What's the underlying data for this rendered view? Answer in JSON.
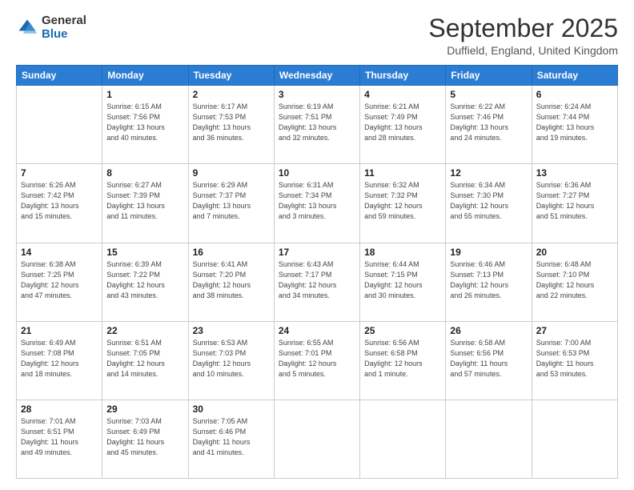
{
  "header": {
    "logo_general": "General",
    "logo_blue": "Blue",
    "title": "September 2025",
    "location": "Duffield, England, United Kingdom"
  },
  "days_of_week": [
    "Sunday",
    "Monday",
    "Tuesday",
    "Wednesday",
    "Thursday",
    "Friday",
    "Saturday"
  ],
  "weeks": [
    [
      {
        "day": "",
        "info": ""
      },
      {
        "day": "1",
        "info": "Sunrise: 6:15 AM\nSunset: 7:56 PM\nDaylight: 13 hours\nand 40 minutes."
      },
      {
        "day": "2",
        "info": "Sunrise: 6:17 AM\nSunset: 7:53 PM\nDaylight: 13 hours\nand 36 minutes."
      },
      {
        "day": "3",
        "info": "Sunrise: 6:19 AM\nSunset: 7:51 PM\nDaylight: 13 hours\nand 32 minutes."
      },
      {
        "day": "4",
        "info": "Sunrise: 6:21 AM\nSunset: 7:49 PM\nDaylight: 13 hours\nand 28 minutes."
      },
      {
        "day": "5",
        "info": "Sunrise: 6:22 AM\nSunset: 7:46 PM\nDaylight: 13 hours\nand 24 minutes."
      },
      {
        "day": "6",
        "info": "Sunrise: 6:24 AM\nSunset: 7:44 PM\nDaylight: 13 hours\nand 19 minutes."
      }
    ],
    [
      {
        "day": "7",
        "info": "Sunrise: 6:26 AM\nSunset: 7:42 PM\nDaylight: 13 hours\nand 15 minutes."
      },
      {
        "day": "8",
        "info": "Sunrise: 6:27 AM\nSunset: 7:39 PM\nDaylight: 13 hours\nand 11 minutes."
      },
      {
        "day": "9",
        "info": "Sunrise: 6:29 AM\nSunset: 7:37 PM\nDaylight: 13 hours\nand 7 minutes."
      },
      {
        "day": "10",
        "info": "Sunrise: 6:31 AM\nSunset: 7:34 PM\nDaylight: 13 hours\nand 3 minutes."
      },
      {
        "day": "11",
        "info": "Sunrise: 6:32 AM\nSunset: 7:32 PM\nDaylight: 12 hours\nand 59 minutes."
      },
      {
        "day": "12",
        "info": "Sunrise: 6:34 AM\nSunset: 7:30 PM\nDaylight: 12 hours\nand 55 minutes."
      },
      {
        "day": "13",
        "info": "Sunrise: 6:36 AM\nSunset: 7:27 PM\nDaylight: 12 hours\nand 51 minutes."
      }
    ],
    [
      {
        "day": "14",
        "info": "Sunrise: 6:38 AM\nSunset: 7:25 PM\nDaylight: 12 hours\nand 47 minutes."
      },
      {
        "day": "15",
        "info": "Sunrise: 6:39 AM\nSunset: 7:22 PM\nDaylight: 12 hours\nand 43 minutes."
      },
      {
        "day": "16",
        "info": "Sunrise: 6:41 AM\nSunset: 7:20 PM\nDaylight: 12 hours\nand 38 minutes."
      },
      {
        "day": "17",
        "info": "Sunrise: 6:43 AM\nSunset: 7:17 PM\nDaylight: 12 hours\nand 34 minutes."
      },
      {
        "day": "18",
        "info": "Sunrise: 6:44 AM\nSunset: 7:15 PM\nDaylight: 12 hours\nand 30 minutes."
      },
      {
        "day": "19",
        "info": "Sunrise: 6:46 AM\nSunset: 7:13 PM\nDaylight: 12 hours\nand 26 minutes."
      },
      {
        "day": "20",
        "info": "Sunrise: 6:48 AM\nSunset: 7:10 PM\nDaylight: 12 hours\nand 22 minutes."
      }
    ],
    [
      {
        "day": "21",
        "info": "Sunrise: 6:49 AM\nSunset: 7:08 PM\nDaylight: 12 hours\nand 18 minutes."
      },
      {
        "day": "22",
        "info": "Sunrise: 6:51 AM\nSunset: 7:05 PM\nDaylight: 12 hours\nand 14 minutes."
      },
      {
        "day": "23",
        "info": "Sunrise: 6:53 AM\nSunset: 7:03 PM\nDaylight: 12 hours\nand 10 minutes."
      },
      {
        "day": "24",
        "info": "Sunrise: 6:55 AM\nSunset: 7:01 PM\nDaylight: 12 hours\nand 5 minutes."
      },
      {
        "day": "25",
        "info": "Sunrise: 6:56 AM\nSunset: 6:58 PM\nDaylight: 12 hours\nand 1 minute."
      },
      {
        "day": "26",
        "info": "Sunrise: 6:58 AM\nSunset: 6:56 PM\nDaylight: 11 hours\nand 57 minutes."
      },
      {
        "day": "27",
        "info": "Sunrise: 7:00 AM\nSunset: 6:53 PM\nDaylight: 11 hours\nand 53 minutes."
      }
    ],
    [
      {
        "day": "28",
        "info": "Sunrise: 7:01 AM\nSunset: 6:51 PM\nDaylight: 11 hours\nand 49 minutes."
      },
      {
        "day": "29",
        "info": "Sunrise: 7:03 AM\nSunset: 6:49 PM\nDaylight: 11 hours\nand 45 minutes."
      },
      {
        "day": "30",
        "info": "Sunrise: 7:05 AM\nSunset: 6:46 PM\nDaylight: 11 hours\nand 41 minutes."
      },
      {
        "day": "",
        "info": ""
      },
      {
        "day": "",
        "info": ""
      },
      {
        "day": "",
        "info": ""
      },
      {
        "day": "",
        "info": ""
      }
    ]
  ]
}
